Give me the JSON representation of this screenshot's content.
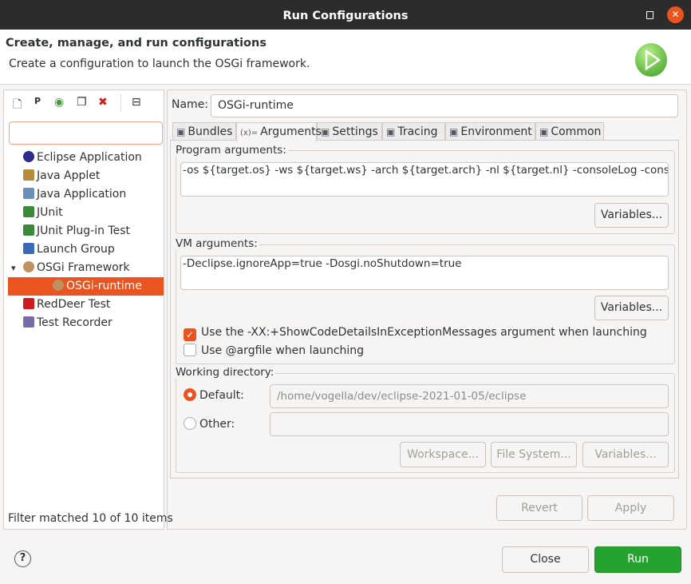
{
  "window": {
    "title": "Run Configurations"
  },
  "header": {
    "title": "Create, manage, and run configurations",
    "subtitle": "Create a configuration to launch the OSGi framework."
  },
  "sidebar": {
    "toolbar": [
      "new-config-icon",
      "new-prototype-icon",
      "export-icon",
      "duplicate-icon",
      "delete-icon",
      "collapse-all-icon"
    ],
    "filter_value": "",
    "items": [
      {
        "label": "Eclipse Application",
        "icon": "eclipse-icon"
      },
      {
        "label": "Java Applet",
        "icon": "java-applet-icon"
      },
      {
        "label": "Java Application",
        "icon": "java-app-icon"
      },
      {
        "label": "JUnit",
        "icon": "junit-icon"
      },
      {
        "label": "JUnit Plug-in Test",
        "icon": "junit-plugin-icon"
      },
      {
        "label": "Launch Group",
        "icon": "launch-group-icon"
      },
      {
        "label": "OSGi Framework",
        "icon": "osgi-icon",
        "expanded": true
      },
      {
        "label": "OSGi-runtime",
        "icon": "osgi-icon",
        "selected": true
      },
      {
        "label": "RedDeer Test",
        "icon": "reddeer-icon"
      },
      {
        "label": "Test Recorder",
        "icon": "test-recorder-icon"
      }
    ],
    "status": "Filter matched 10 of 10 items"
  },
  "main": {
    "name_label": "Name:",
    "name_value": "OSGi-runtime",
    "tabs": [
      {
        "label": "Bundles"
      },
      {
        "label": "Arguments",
        "active": true
      },
      {
        "label": "Settings"
      },
      {
        "label": "Tracing"
      },
      {
        "label": "Environment"
      },
      {
        "label": "Common"
      }
    ],
    "program_args": {
      "label": "Program arguments:",
      "value": "-os ${target.os} -ws ${target.ws} -arch ${target.arch} -nl ${target.nl} -consoleLog -console",
      "variables": "Variables..."
    },
    "vm_args": {
      "label": "VM arguments:",
      "value": "-Declipse.ignoreApp=true -Dosgi.noShutdown=true",
      "variables": "Variables...",
      "check1": {
        "label": "Use the -XX:+ShowCodeDetailsInExceptionMessages argument when launching",
        "checked": true
      },
      "check2": {
        "label": "Use @argfile when launching",
        "checked": false
      }
    },
    "working_dir": {
      "label": "Working directory:",
      "default_label": "Default:",
      "default_value": "/home/vogella/dev/eclipse-2021-01-05/eclipse",
      "other_label": "Other:",
      "other_value": "",
      "selected": "Default",
      "workspace": "Workspace...",
      "filesystem": "File System...",
      "variables": "Variables..."
    },
    "revert": "Revert",
    "apply": "Apply"
  },
  "footer": {
    "close": "Close",
    "run": "Run"
  },
  "colors": {
    "selection": "#e95420",
    "run": "#26a22e",
    "titlebar": "#2c2c2c"
  }
}
